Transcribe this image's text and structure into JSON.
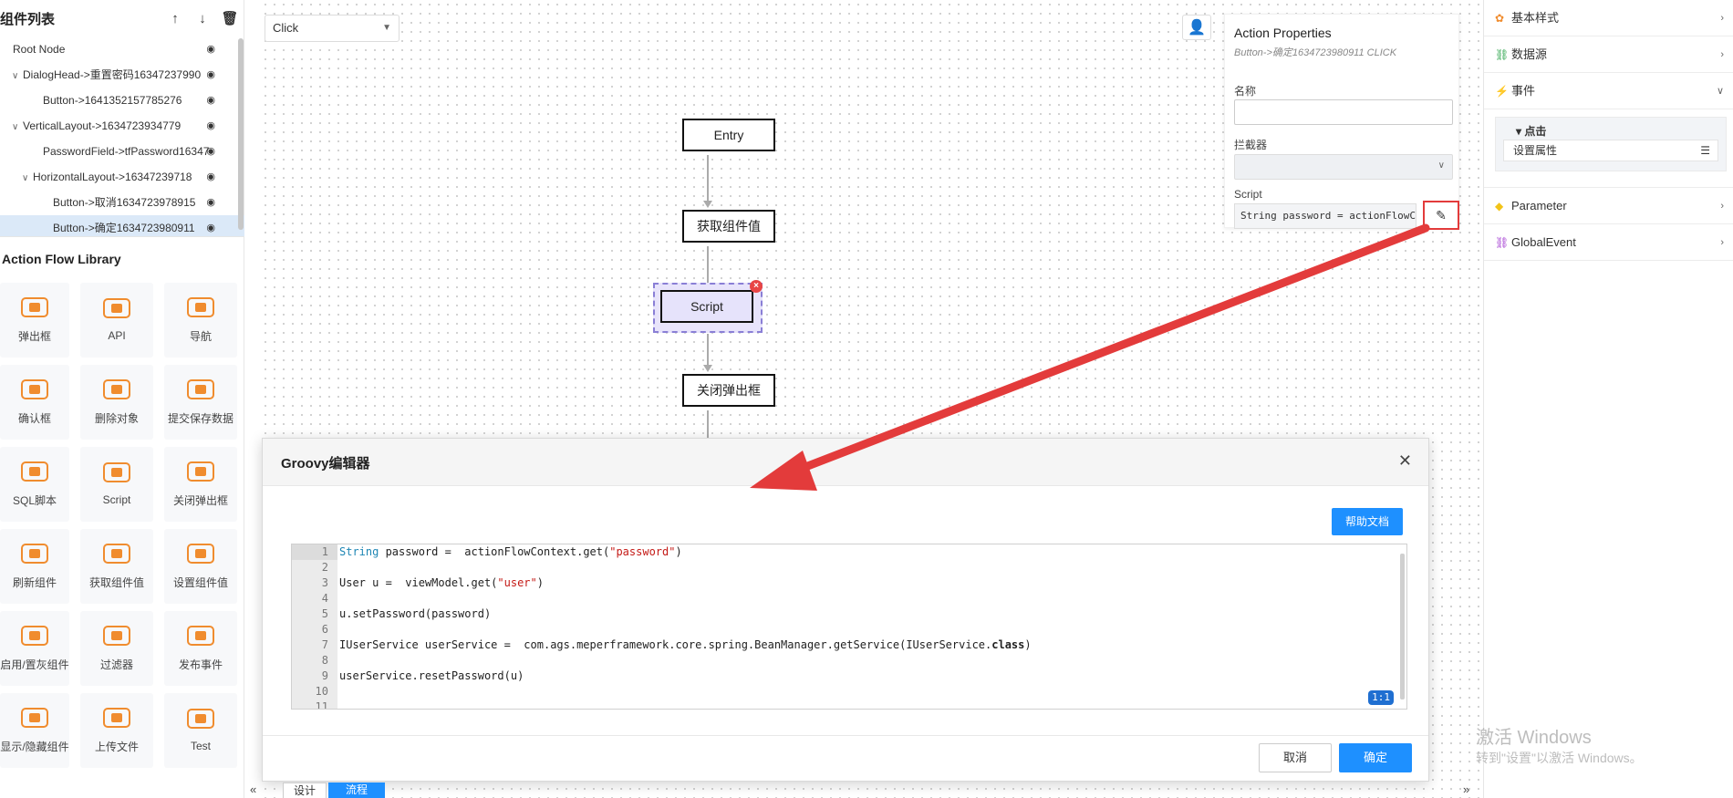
{
  "component_panel": {
    "title": "组件列表",
    "buttons": [
      "↑",
      "↓",
      "🗑"
    ],
    "tree": [
      {
        "label": "Root Node",
        "indent": 0,
        "chevron": ""
      },
      {
        "label": "DialogHead->重置密码16347237990",
        "indent": 1,
        "chevron": "v"
      },
      {
        "label": "Button->1641352157785276",
        "indent": 3,
        "chevron": ""
      },
      {
        "label": "VerticalLayout->1634723934779",
        "indent": 1,
        "chevron": "v"
      },
      {
        "label": "PasswordField->tfPassword16347",
        "indent": 3,
        "chevron": ""
      },
      {
        "label": "HorizontalLayout->16347239718",
        "indent": 2,
        "chevron": "v"
      },
      {
        "label": "Button->取消1634723978915",
        "indent": 4,
        "chevron": ""
      },
      {
        "label": "Button->确定1634723980911",
        "indent": 4,
        "chevron": "",
        "selected": true
      }
    ]
  },
  "library": {
    "title": "Action Flow Library",
    "items": [
      "弹出框",
      "API",
      "导航",
      "确认框",
      "删除对象",
      "提交保存数据",
      "SQL脚本",
      "Script",
      "关闭弹出框",
      "刷新组件",
      "获取组件值",
      "设置组件值",
      "启用/置灰组件",
      "过滤器",
      "发布事件",
      "显示/隐藏组件",
      "上传文件",
      "Test"
    ]
  },
  "canvas": {
    "event_select": "Click",
    "nodes": {
      "entry": "Entry",
      "get_value": "获取组件值",
      "script": "Script",
      "close_dialog": "关闭弹出框"
    }
  },
  "action_props": {
    "title": "Action Properties",
    "subtitle": "Button->确定1634723980911 CLICK",
    "name_label": "名称",
    "interceptor_label": "拦截器",
    "script_label": "Script",
    "script_value": "String password =  actionFlowContext.get(\"password\")"
  },
  "right_panel": {
    "sections": [
      "基本样式",
      "数据源",
      "事件",
      "Parameter",
      "GlobalEvent"
    ],
    "click_title": "点击",
    "set_prop": "设置属性"
  },
  "groovy_editor": {
    "title": "Groovy编辑器",
    "help_button": "帮助文档",
    "cancel": "取消",
    "confirm": "确定",
    "cursor_pos": "1:1",
    "line_numbers": [
      "1",
      "2",
      "3",
      "4",
      "5",
      "6",
      "7",
      "8",
      "9",
      "10",
      "11"
    ]
  },
  "bottom_tabs": {
    "design": "设计",
    "flow": "流程"
  },
  "watermark": {
    "line1": "激活 Windows",
    "line2": "转到\"设置\"以激活 Windows。"
  },
  "colors": {
    "accent": "#1e90ff",
    "annotation": "#e33b3b",
    "flow_script": "#e6e3fb"
  }
}
